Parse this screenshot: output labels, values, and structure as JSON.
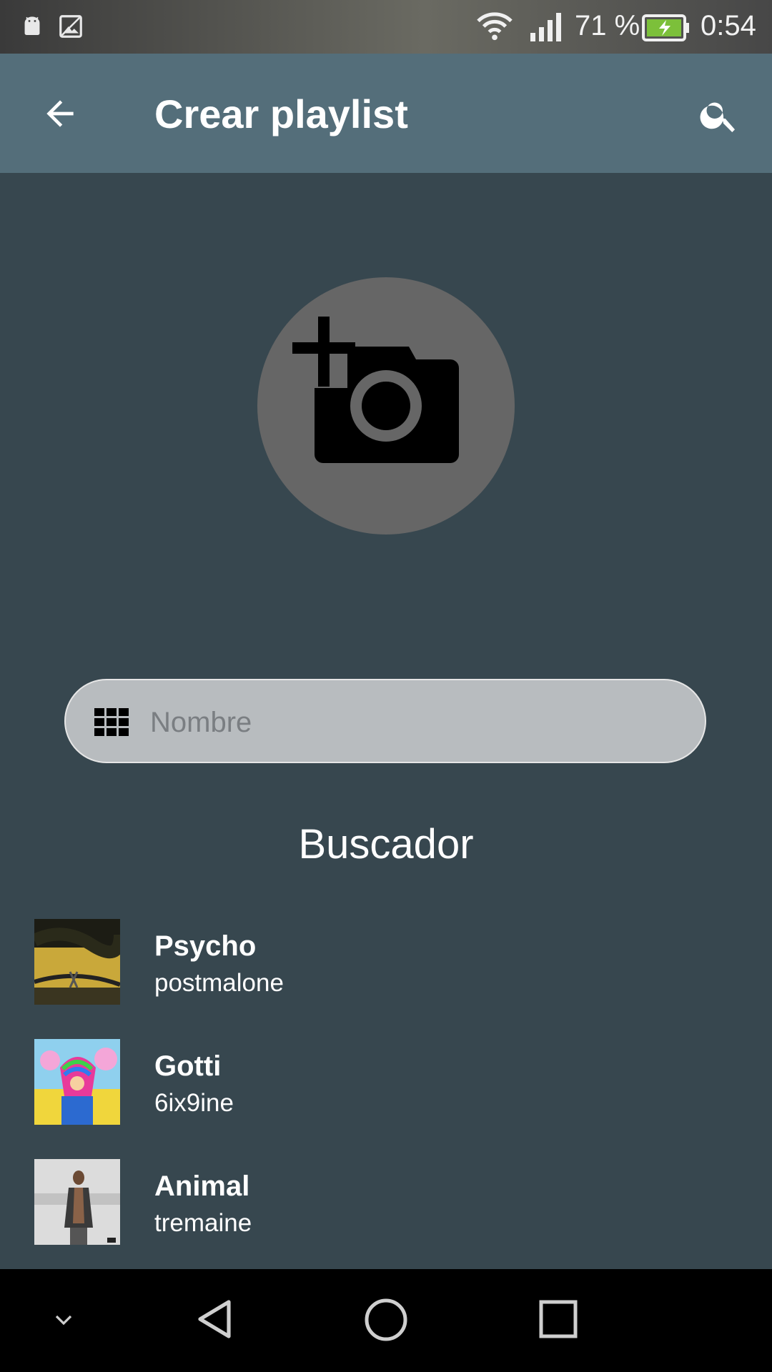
{
  "status_bar": {
    "battery_percent": "71 %",
    "time": "0:54",
    "icons": [
      "android-icon",
      "image-icon",
      "wifi-icon",
      "signal-icon",
      "battery-charging-icon"
    ]
  },
  "app_bar": {
    "title": "Crear playlist",
    "back_icon": "arrow-back-icon",
    "search_icon": "search-icon",
    "background": "#546e7a"
  },
  "cover_picker": {
    "icon": "add-photo-icon"
  },
  "name_input": {
    "placeholder": "Nombre",
    "value": "",
    "icon": "grid-icon"
  },
  "search_section": {
    "title": "Buscador"
  },
  "songs": [
    {
      "title": "Psycho",
      "artist": "postmalone"
    },
    {
      "title": "Gotti",
      "artist": "6ix9ine"
    },
    {
      "title": "Animal",
      "artist": "tremaine"
    }
  ],
  "nav_bar": {
    "icons": [
      "chevron-down-icon",
      "back-triangle-icon",
      "home-circle-icon",
      "recents-square-icon"
    ]
  },
  "colors": {
    "background": "#37474f",
    "app_bar": "#546e7a",
    "avatar": "#666666",
    "input": "#b8bcbf"
  }
}
